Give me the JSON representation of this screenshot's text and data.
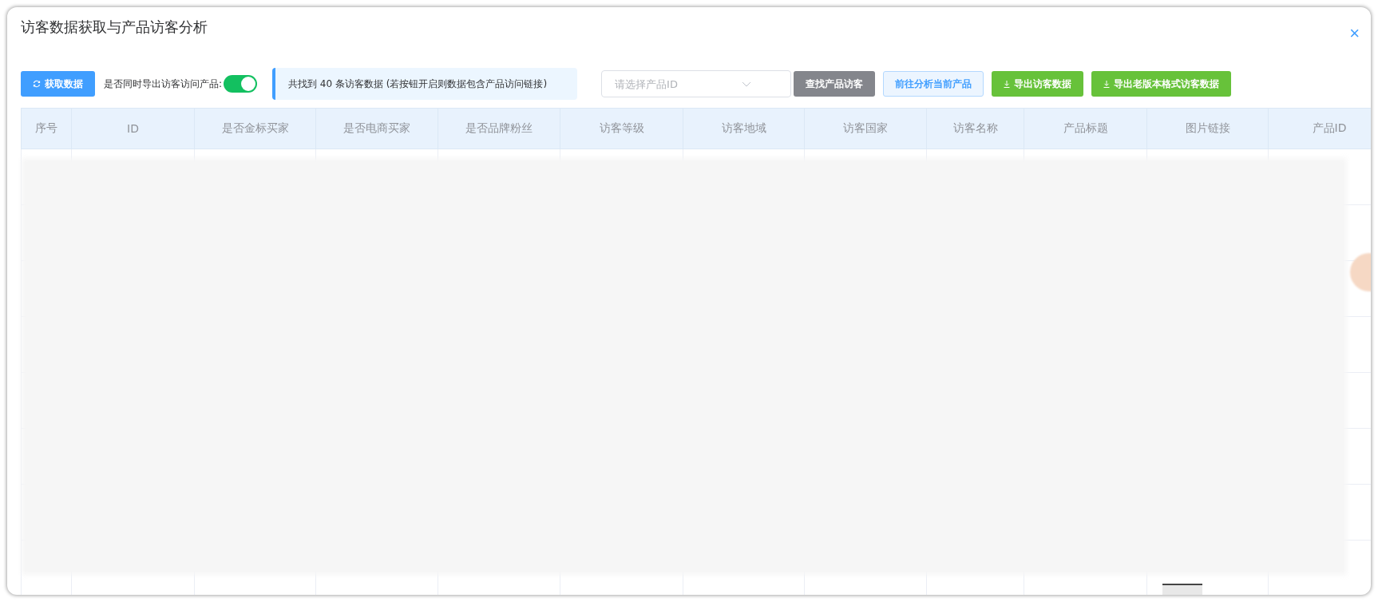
{
  "dialog": {
    "title": "访客数据获取与产品访客分析",
    "close": "×"
  },
  "toolbar": {
    "fetch_button": "获取数据",
    "toggle_label": "是否同时导出访客访问产品:",
    "toggle_on": true,
    "notice": "共找到 40 条访客数据 (若按钮开启则数据包含产品访问链接)",
    "product_select": {
      "placeholder": "请选择产品ID"
    },
    "buttons": [
      {
        "label": "查找产品访客",
        "kind": "gray"
      },
      {
        "label": "前往分析当前产品",
        "kind": "plain"
      },
      {
        "label": "导出访客数据",
        "kind": "export"
      },
      {
        "label": "导出老版本格式访客数据",
        "kind": "export"
      }
    ]
  },
  "table": {
    "columns": [
      "序号",
      "ID",
      "是否金标买家",
      "是否电商买家",
      "是否品牌粉丝",
      "访客等级",
      "访客地域",
      "访客国家",
      "访客名称",
      "产品标题",
      "图片链接",
      "产品ID"
    ]
  }
}
